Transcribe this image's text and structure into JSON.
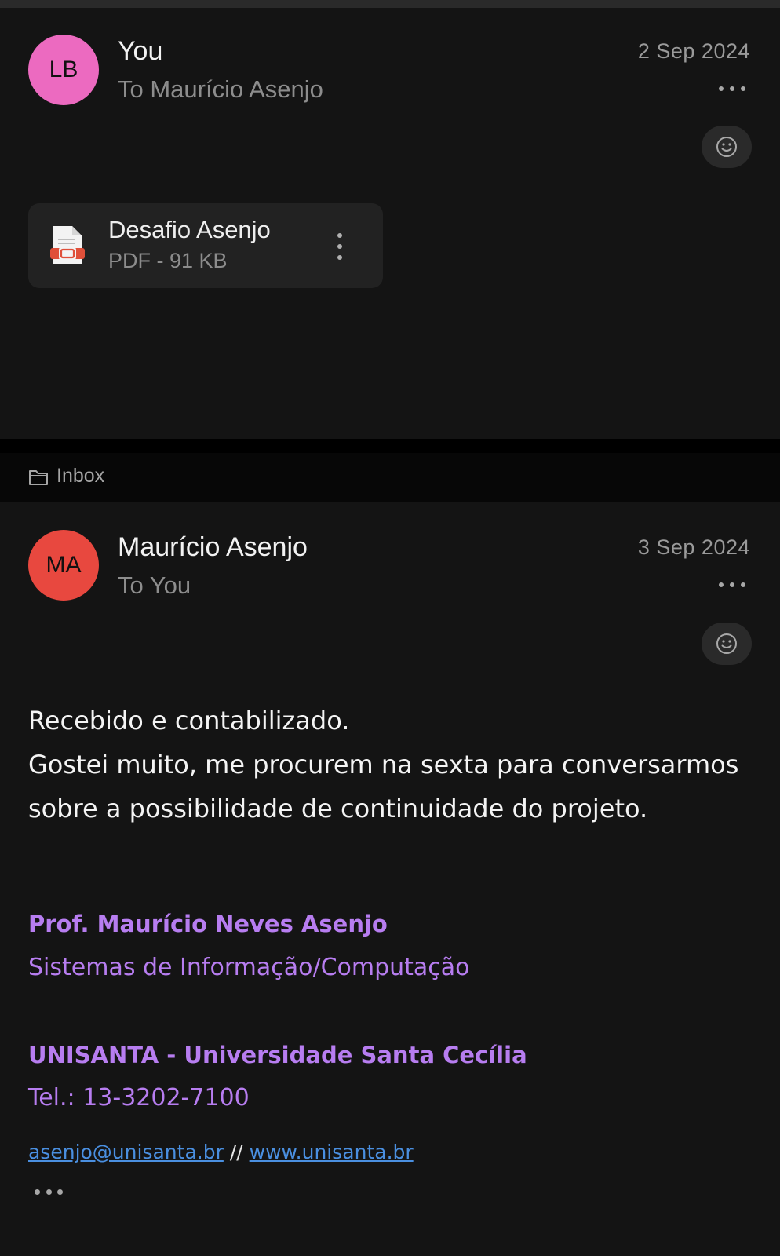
{
  "messages": [
    {
      "avatar_initials": "LB",
      "avatar_color": "#ec6ac0",
      "sender": "You",
      "recipient": "To Maurício Asenjo",
      "date": "2 Sep 2024",
      "attachment": {
        "name": "Desafio Asenjo",
        "meta": "PDF - 91 KB",
        "icon": "pdf-file-icon"
      }
    },
    {
      "folder": {
        "label": "Inbox",
        "icon": "folder-icon"
      },
      "avatar_initials": "MA",
      "avatar_color": "#e8483f",
      "sender": "Maurício Asenjo",
      "recipient": "To You",
      "date": "3 Sep 2024",
      "body": [
        "Recebido e contabilizado.",
        "Gostei muito, me procurem na sexta para conversarmos",
        "sobre a possibilidade de continuidade do projeto."
      ],
      "signature": {
        "name": "Prof. Maurício Neves Asenjo",
        "department": "Sistemas de Informação/Computação",
        "institution": "UNISANTA - Universidade Santa Cecília",
        "phone": "Tel.: 13-3202-7100",
        "email": "asenjo@unisanta.br",
        "separator": "//",
        "website": "www.unisanta.br"
      }
    }
  ],
  "icons": {
    "more": "more-horizontal-icon",
    "reaction": "smiley-icon",
    "attachment_menu": "more-vertical-icon"
  },
  "colors": {
    "background": "#141414",
    "signature_purple": "#b77df0",
    "link_blue": "#4a8fe0"
  }
}
